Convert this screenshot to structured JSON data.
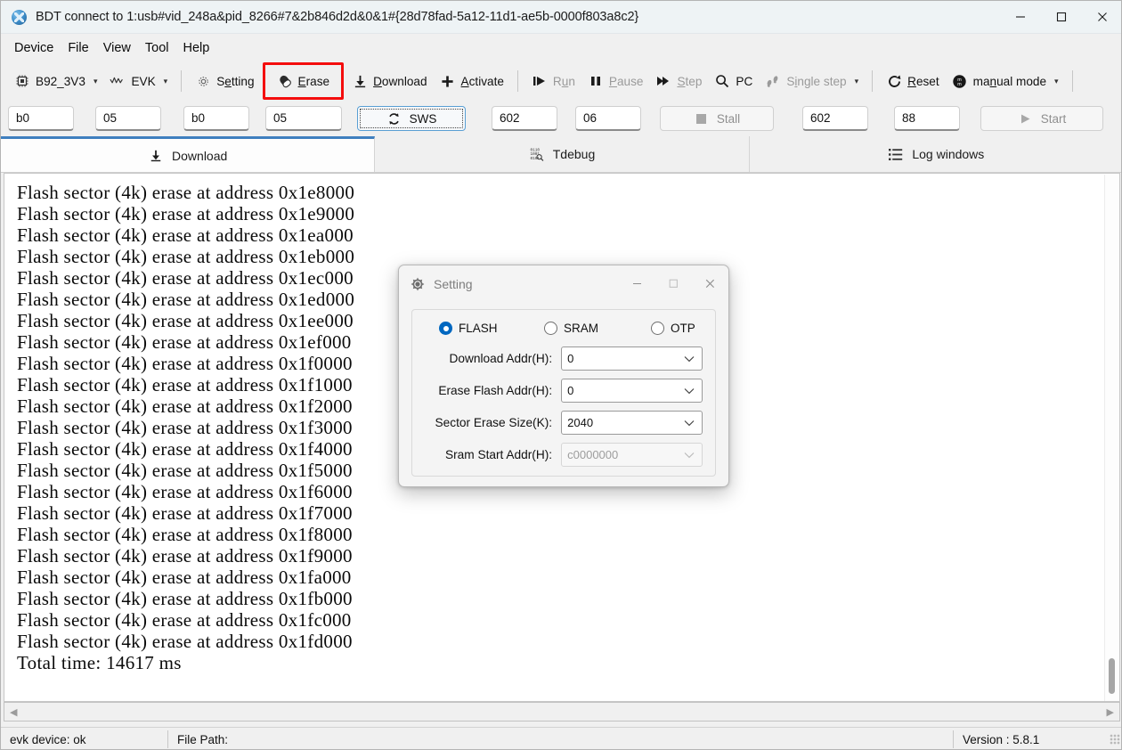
{
  "window": {
    "title": "BDT connect to 1:usb#vid_248a&pid_8266#7&2b846d2d&0&1#{28d78fad-5a12-11d1-ae5b-0000f803a8c2}",
    "icon": "bdt-app-icon",
    "minimize": "minimize-icon",
    "maximize": "maximize-icon",
    "close": "close-icon"
  },
  "menu": {
    "items": [
      {
        "label": "Device"
      },
      {
        "label": "File"
      },
      {
        "label": "View"
      },
      {
        "label": "Tool"
      },
      {
        "label": "Help"
      }
    ]
  },
  "toolbar": {
    "chip_select": {
      "label": "B92_3V3",
      "icon": "chip-icon",
      "caret": "▾"
    },
    "evk_select": {
      "label": "EVK",
      "icon": "waveform-icon",
      "caret": "▾"
    },
    "setting": {
      "label": "Setting",
      "icon": "gear-icon"
    },
    "erase": {
      "label": "Erase",
      "icon": "eraser-icon",
      "highlight_color": "#f40d0d"
    },
    "download": {
      "label": "Download",
      "icon": "download-arrow-icon"
    },
    "activate": {
      "label": "Activate",
      "icon": "plus-icon"
    },
    "run": {
      "label": "Run",
      "icon": "run-icon",
      "enabled": false
    },
    "pause": {
      "label": "Pause",
      "icon": "pause-icon",
      "enabled": false
    },
    "step": {
      "label": "Step",
      "icon": "step-icon",
      "enabled": false
    },
    "pc": {
      "label": "PC",
      "icon": "magnifier-icon"
    },
    "single_step": {
      "label": "Single step",
      "icon": "footsteps-icon",
      "caret": "▾",
      "enabled": false
    },
    "reset": {
      "label": "Reset",
      "icon": "reset-icon"
    },
    "mode_select": {
      "label": "manual mode",
      "icon": "mode-circle-icon",
      "caret": "▾"
    }
  },
  "address_bar": {
    "field1": "b0",
    "field2": "05",
    "field3": "b0",
    "field4": "05",
    "sws_button": {
      "label": "SWS",
      "icon": "refresh-icon"
    },
    "field5": "602",
    "field6": "06",
    "stall_button": {
      "label": "Stall",
      "icon": "stop-square-icon",
      "enabled": false
    },
    "field7": "602",
    "field8": "88",
    "start_button": {
      "label": "Start",
      "icon": "play-icon",
      "enabled": false
    }
  },
  "tabs": [
    {
      "label": "Download",
      "icon": "download-arrow-icon",
      "active": true
    },
    {
      "label": "Tdebug",
      "icon": "binary-icon",
      "active": false
    },
    {
      "label": "Log windows",
      "icon": "list-icon",
      "active": false
    }
  ],
  "log": {
    "lines": [
      "Flash sector (4k) erase at address 0x1e8000",
      "Flash sector (4k) erase at address 0x1e9000",
      "Flash sector (4k) erase at address 0x1ea000",
      "Flash sector (4k) erase at address 0x1eb000",
      "Flash sector (4k) erase at address 0x1ec000",
      "Flash sector (4k) erase at address 0x1ed000",
      "Flash sector (4k) erase at address 0x1ee000",
      "Flash sector (4k) erase at address 0x1ef000",
      "Flash sector (4k) erase at address 0x1f0000",
      "Flash sector (4k) erase at address 0x1f1000",
      "Flash sector (4k) erase at address 0x1f2000",
      "Flash sector (4k) erase at address 0x1f3000",
      "Flash sector (4k) erase at address 0x1f4000",
      "Flash sector (4k) erase at address 0x1f5000",
      "Flash sector (4k) erase at address 0x1f6000",
      "Flash sector (4k) erase at address 0x1f7000",
      "Flash sector (4k) erase at address 0x1f8000",
      "Flash sector (4k) erase at address 0x1f9000",
      "Flash sector (4k) erase at address 0x1fa000",
      "Flash sector (4k) erase at address 0x1fb000",
      "Flash sector (4k) erase at address 0x1fc000",
      "Flash sector (4k) erase at address 0x1fd000",
      "Total time: 14617 ms"
    ]
  },
  "dialog": {
    "title": "Setting",
    "icon": "setting-gear-icon",
    "minimize": "minimize-icon",
    "maximize": "maximize-icon",
    "close": "close-icon",
    "memory_type": {
      "options": [
        {
          "label": "FLASH",
          "selected": true
        },
        {
          "label": "SRAM",
          "selected": false
        },
        {
          "label": "OTP",
          "selected": false
        }
      ]
    },
    "fields": [
      {
        "label": "Download  Addr(H):",
        "value": "0",
        "disabled": false
      },
      {
        "label": "Erase Flash Addr(H):",
        "value": "0",
        "disabled": false
      },
      {
        "label": "Sector Erase Size(K):",
        "value": "2040",
        "disabled": false
      },
      {
        "label": "Sram Start Addr(H):",
        "value": "c0000000",
        "disabled": true
      }
    ]
  },
  "statusbar": {
    "device_status": "evk device: ok",
    "file_path": "File Path:",
    "version": "Version : 5.8.1"
  },
  "scrollbars": {
    "h_left": "◀",
    "h_right": "▶"
  }
}
